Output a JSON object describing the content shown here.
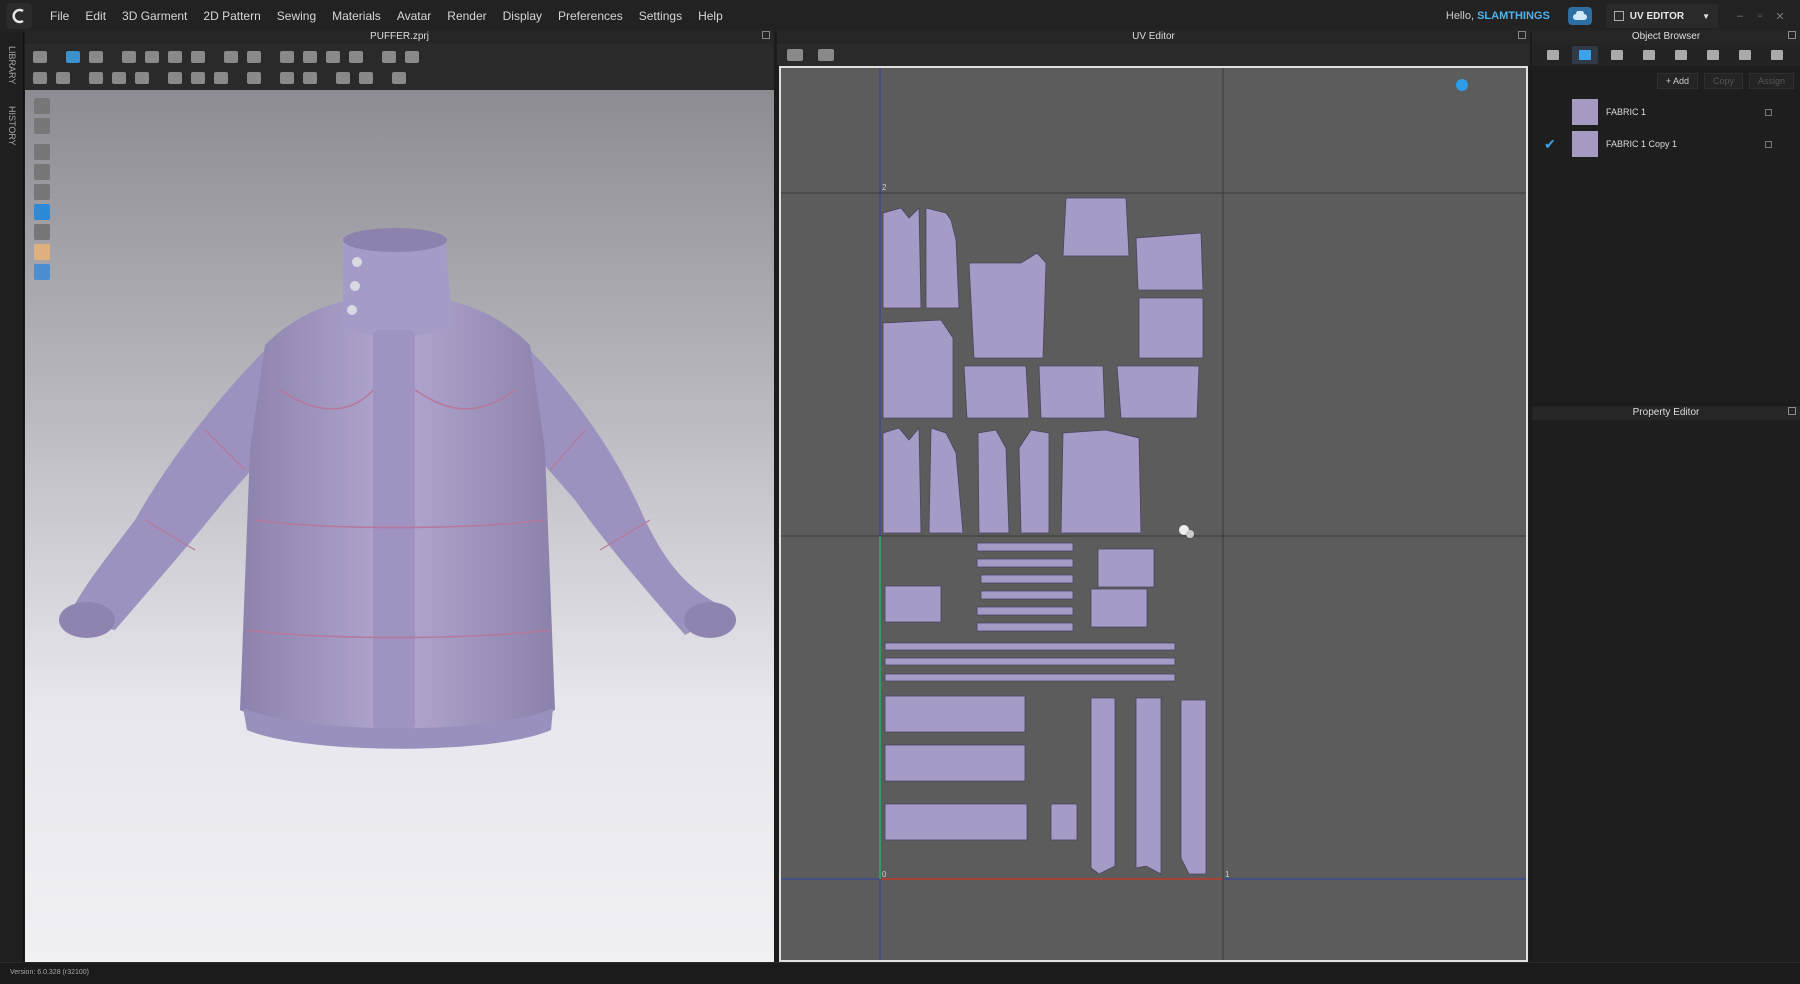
{
  "menu": [
    "File",
    "Edit",
    "3D Garment",
    "2D Pattern",
    "Sewing",
    "Materials",
    "Avatar",
    "Render",
    "Display",
    "Preferences",
    "Settings",
    "Help"
  ],
  "user": {
    "greeting": "Hello,",
    "name": "SLAMTHINGS"
  },
  "mode": {
    "label": "UV EDITOR"
  },
  "side_tabs": {
    "library": "LIBRARY",
    "history": "HISTORY"
  },
  "viewport3d": {
    "title": "PUFFER.zprj"
  },
  "uv_editor": {
    "title": "UV Editor",
    "axis_labels": {
      "zero": "0",
      "one": "1",
      "two": "2"
    }
  },
  "object_browser": {
    "title": "Object Browser",
    "actions": {
      "add": "+ Add",
      "copy": "Copy",
      "assign": "Assign"
    },
    "fabrics": [
      {
        "name": "FABRIC 1",
        "checked": false,
        "color": "#a69ac3"
      },
      {
        "name": "FABRIC 1 Copy 1",
        "checked": true,
        "color": "#a69ac3"
      }
    ]
  },
  "property_editor": {
    "title": "Property Editor"
  },
  "status": {
    "version": "Version: 6.0.328 (r32100)"
  },
  "colors": {
    "accent": "#3da3e8",
    "fabric": "#a69ac3"
  }
}
